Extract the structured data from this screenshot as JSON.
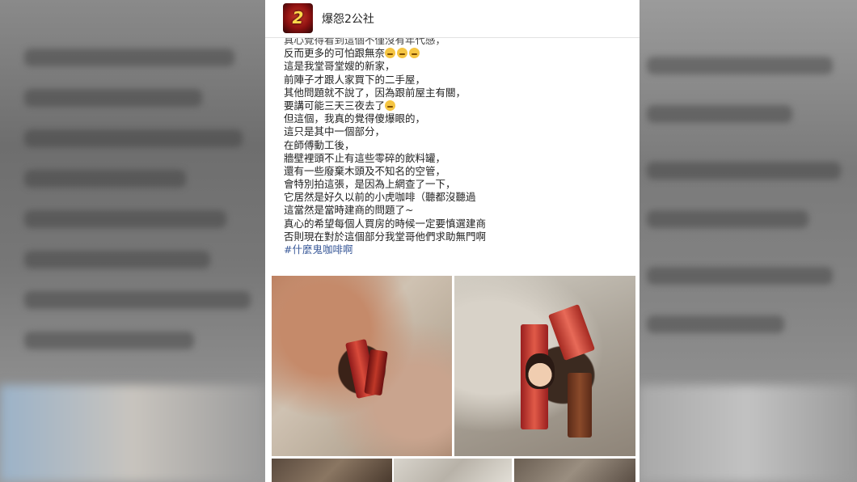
{
  "page": {
    "name": "爆怨2公社",
    "avatar_text": "2"
  },
  "post": {
    "lines": [
      "真心覺得看到這個不僅沒有年代感，",
      "反而更多的可怕跟無奈",
      "這是我堂哥堂嫂的新家，",
      "前陣子才跟人家買下的二手屋，",
      "其他問題就不說了，因為跟前屋主有關，",
      "要講可能三天三夜去了",
      "但這個，我真的覺得傻爆眼的，",
      "這只是其中一個部分，",
      "在師傅動工後，",
      "牆壁裡頭不止有這些零碎的飲料罐，",
      "還有一些廢棄木頭及不知名的空管，",
      "會特別拍這張，是因為上網查了一下，",
      "它居然是好久以前的小虎咖啡（聽都沒聽過",
      "這當然是當時建商的問題了~",
      "真心的希望每個人買房的時候一定要慎選建商",
      "否則現在對於這個部分我堂哥他們求助無門啊"
    ],
    "hashtag": "#什麼鬼咖啡啊"
  },
  "icons": {
    "emoji": "unamused-face-emoji"
  },
  "colors": {
    "hashtag": "#385898",
    "background": "#ffffff"
  }
}
